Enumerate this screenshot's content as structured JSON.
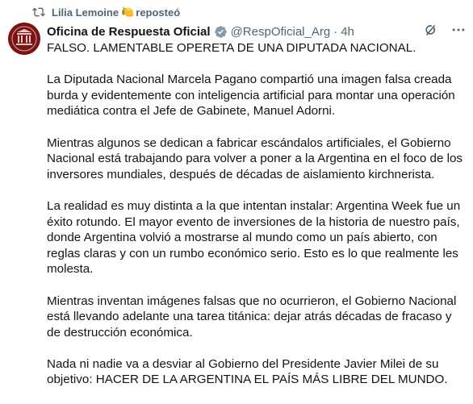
{
  "repost": {
    "user": "Lilia Lemoine",
    "emoji": "🍋",
    "verb": "reposteó"
  },
  "post": {
    "author": "Oficina de Respuesta Oficial",
    "handle": "@RespOficial_Arg",
    "separator": "·",
    "time": "4h",
    "paragraphs": [
      "FALSO. LAMENTABLE OPERETA DE UNA DIPUTADA NACIONAL.",
      "La Diputada Nacional Marcela Pagano compartió una imagen falsa creada burda y evidentemente con inteligencia artificial para montar una operación mediática contra el Jefe de Gabinete, Manuel Adorni.",
      "Mientras algunos se dedican a fabricar escándalos artificiales, el Gobierno Nacional está trabajando para volver a poner a la Argentina en el foco de los inversores mundiales, después de décadas de aislamiento kirchnerista.",
      "La realidad es muy distinta a la que intentan instalar: Argentina Week fue un éxito rotundo. El mayor evento de inversiones de la historia de nuestro país, donde Argentina volvió a mostrarse al mundo como un país abierto, con reglas claras y con un rumbo económico serio. Esto es lo que realmente les molesta.",
      "Mientras inventan imágenes falsas que no ocurrieron, el Gobierno Nacional está llevando adelante una tarea titánica: dejar atrás décadas de fracaso y de destrucción económica.",
      "Nada ni nadie va a desviar al Gobierno del Presidente Javier Milei de su objetivo: HACER DE LA ARGENTINA EL PAÍS MÁS LIBRE DEL MUNDO."
    ]
  },
  "icons": {
    "repost": "repost-icon",
    "verified": "verified-badge-icon",
    "grok": "grok-icon",
    "more": "more-options-icon"
  },
  "colors": {
    "secondary_text": "#536471",
    "primary_text": "#0f1419",
    "verified_gray": "#829aab",
    "avatar_red": "#7a1414"
  }
}
